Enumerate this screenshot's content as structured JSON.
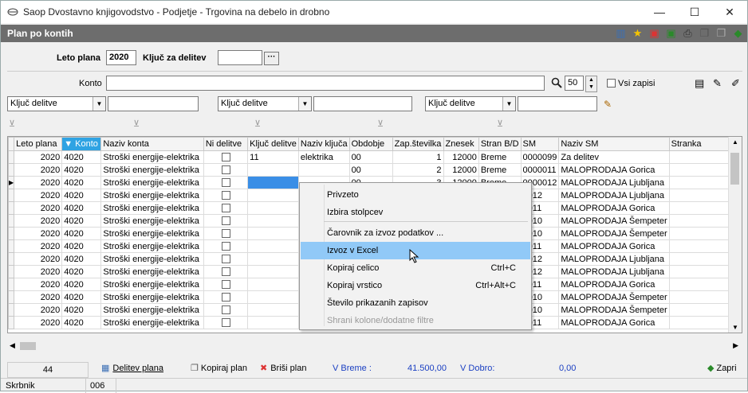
{
  "window": {
    "title": "Saop Dvostavno knjigovodstvo - Podjetje - Trgovina na debelo in drobno",
    "minimize": "—",
    "maximize": "☐",
    "close": "✕"
  },
  "header": {
    "title": "Plan po kontih"
  },
  "form": {
    "leto_label": "Leto plana",
    "leto_value": "2020",
    "kljuc_label": "Ključ za delitev",
    "kljuc_value": "",
    "ellipsis": "···"
  },
  "search": {
    "konto_label": "Konto",
    "konto_value": "",
    "count": "50",
    "vsi_label": "Vsi zapisi"
  },
  "filters": {
    "f1": "Ključ delitve",
    "f2": "Ključ delitve",
    "f3": "Ključ delitve"
  },
  "grid": {
    "columns": [
      "Leto plana",
      "Konto",
      "Naziv konta",
      "Ni delitve",
      "Ključ delitve",
      "Naziv ključa",
      "Obdobje",
      "Zap.številka",
      "Znesek",
      "Stran B/D",
      "SM",
      "Naziv SM",
      "Stranka"
    ],
    "rows": [
      [
        "2020",
        "4020",
        "Stroški energije-elektrika",
        "",
        "11",
        "elektrika",
        "00",
        "1",
        "12000",
        "Breme",
        "0000099",
        "Za delitev",
        ""
      ],
      [
        "2020",
        "4020",
        "Stroški energije-elektrika",
        "",
        "",
        "",
        "00",
        "2",
        "12000",
        "Breme",
        "0000011",
        "MALOPRODAJA Gorica",
        ""
      ],
      [
        "2020",
        "4020",
        "Stroški energije-elektrika",
        "",
        "",
        "",
        "00",
        "3",
        "12000",
        "Breme",
        "0000012",
        "MALOPRODAJA Ljubljana",
        ""
      ],
      [
        "2020",
        "4020",
        "Stroški energije-elektrika",
        "",
        "",
        "",
        "",
        "",
        "",
        "",
        "0012",
        "MALOPRODAJA Ljubljana",
        ""
      ],
      [
        "2020",
        "4020",
        "Stroški energije-elektrika",
        "",
        "",
        "",
        "",
        "",
        "",
        "",
        "0011",
        "MALOPRODAJA Gorica",
        ""
      ],
      [
        "2020",
        "4020",
        "Stroški energije-elektrika",
        "",
        "",
        "",
        "",
        "",
        "",
        "",
        "0010",
        "MALOPRODAJA Šempeter",
        ""
      ],
      [
        "2020",
        "4020",
        "Stroški energije-elektrika",
        "",
        "",
        "",
        "",
        "",
        "",
        "",
        "0010",
        "MALOPRODAJA Šempeter",
        ""
      ],
      [
        "2020",
        "4020",
        "Stroški energije-elektrika",
        "",
        "",
        "",
        "",
        "",
        "",
        "",
        "0011",
        "MALOPRODAJA Gorica",
        ""
      ],
      [
        "2020",
        "4020",
        "Stroški energije-elektrika",
        "",
        "",
        "",
        "",
        "",
        "",
        "",
        "0012",
        "MALOPRODAJA Ljubljana",
        ""
      ],
      [
        "2020",
        "4020",
        "Stroški energije-elektrika",
        "",
        "",
        "",
        "",
        "",
        "",
        "",
        "0012",
        "MALOPRODAJA Ljubljana",
        ""
      ],
      [
        "2020",
        "4020",
        "Stroški energije-elektrika",
        "",
        "",
        "",
        "",
        "",
        "",
        "",
        "0011",
        "MALOPRODAJA Gorica",
        ""
      ],
      [
        "2020",
        "4020",
        "Stroški energije-elektrika",
        "",
        "",
        "",
        "",
        "",
        "",
        "",
        "0010",
        "MALOPRODAJA Šempeter",
        ""
      ],
      [
        "2020",
        "4020",
        "Stroški energije-elektrika",
        "",
        "",
        "",
        "",
        "",
        "",
        "",
        "0010",
        "MALOPRODAJA Šempeter",
        ""
      ],
      [
        "2020",
        "4020",
        "Stroški energije-elektrika",
        "",
        "",
        "",
        "",
        "",
        "",
        "",
        "0011",
        "MALOPRODAJA Gorica",
        ""
      ]
    ]
  },
  "context_menu": [
    {
      "label": "Privzeto",
      "shortcut": ""
    },
    {
      "label": "Izbira stolpcev",
      "shortcut": ""
    },
    {
      "label": "Čarovnik za izvoz podatkov ...",
      "shortcut": ""
    },
    {
      "label": "Izvoz v Excel",
      "shortcut": ""
    },
    {
      "label": "Kopiraj celico",
      "shortcut": "Ctrl+C"
    },
    {
      "label": "Kopiraj vrstico",
      "shortcut": "Ctrl+Alt+C"
    },
    {
      "label": "Število prikazanih zapisov",
      "shortcut": ""
    },
    {
      "label": "Shrani kolone/dodatne filtre",
      "shortcut": ""
    }
  ],
  "footer": {
    "count": "44",
    "delitev": "Delitev plana",
    "kopiraj": "Kopiraj plan",
    "brisi": "Briši plan",
    "breme_label": "V Breme :",
    "breme_value": "41.500,00",
    "dobro_label": "V Dobro:",
    "dobro_value": "0,00",
    "zapri": "Zapri"
  },
  "status": {
    "user_label": "Skrbnik",
    "code": "006"
  },
  "colors": {
    "header_bg": "#6d6d6d",
    "sorted_col": "#2fa3e3",
    "highlight": "#91c9f7",
    "selection": "#3a8ee6"
  }
}
